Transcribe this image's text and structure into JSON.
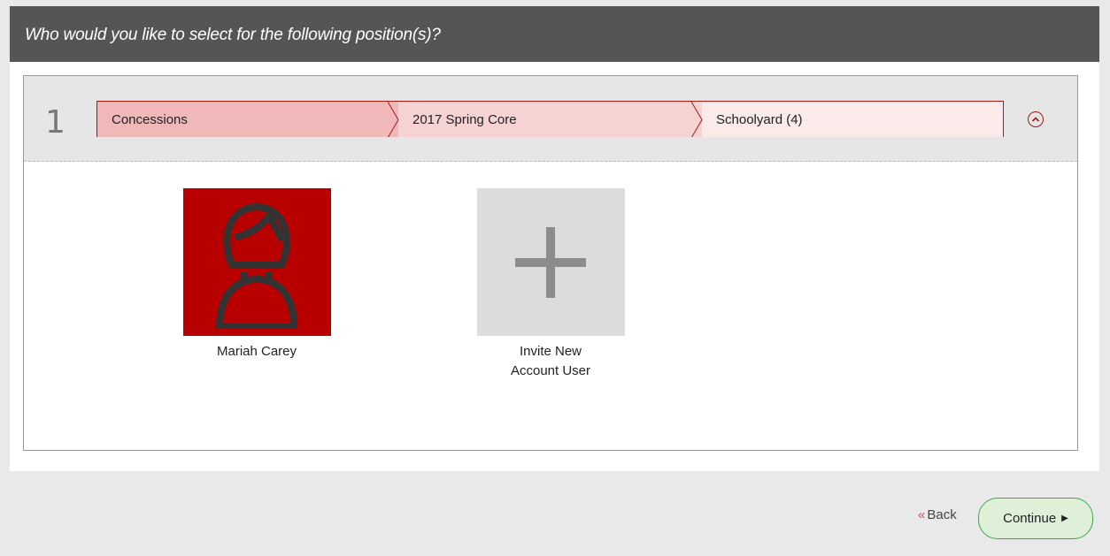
{
  "header": {
    "title": "Who would you like to select for the following position(s)?"
  },
  "position": {
    "number": "1",
    "breadcrumb": [
      "Concessions",
      "2017 Spring Core",
      "Schoolyard (4)"
    ]
  },
  "people": [
    {
      "name": "Mariah Carey",
      "icon": "person-icon"
    },
    {
      "name_line1": "Invite New",
      "name_line2": "Account User",
      "icon": "plus-icon"
    }
  ],
  "footer": {
    "back_chevron": "«",
    "back_label": "Back",
    "continue_label": "Continue",
    "continue_arrow": "▶"
  },
  "colors": {
    "header_bg": "#555555",
    "accent_red": "#b80000",
    "continue_border": "#3aa84a"
  }
}
